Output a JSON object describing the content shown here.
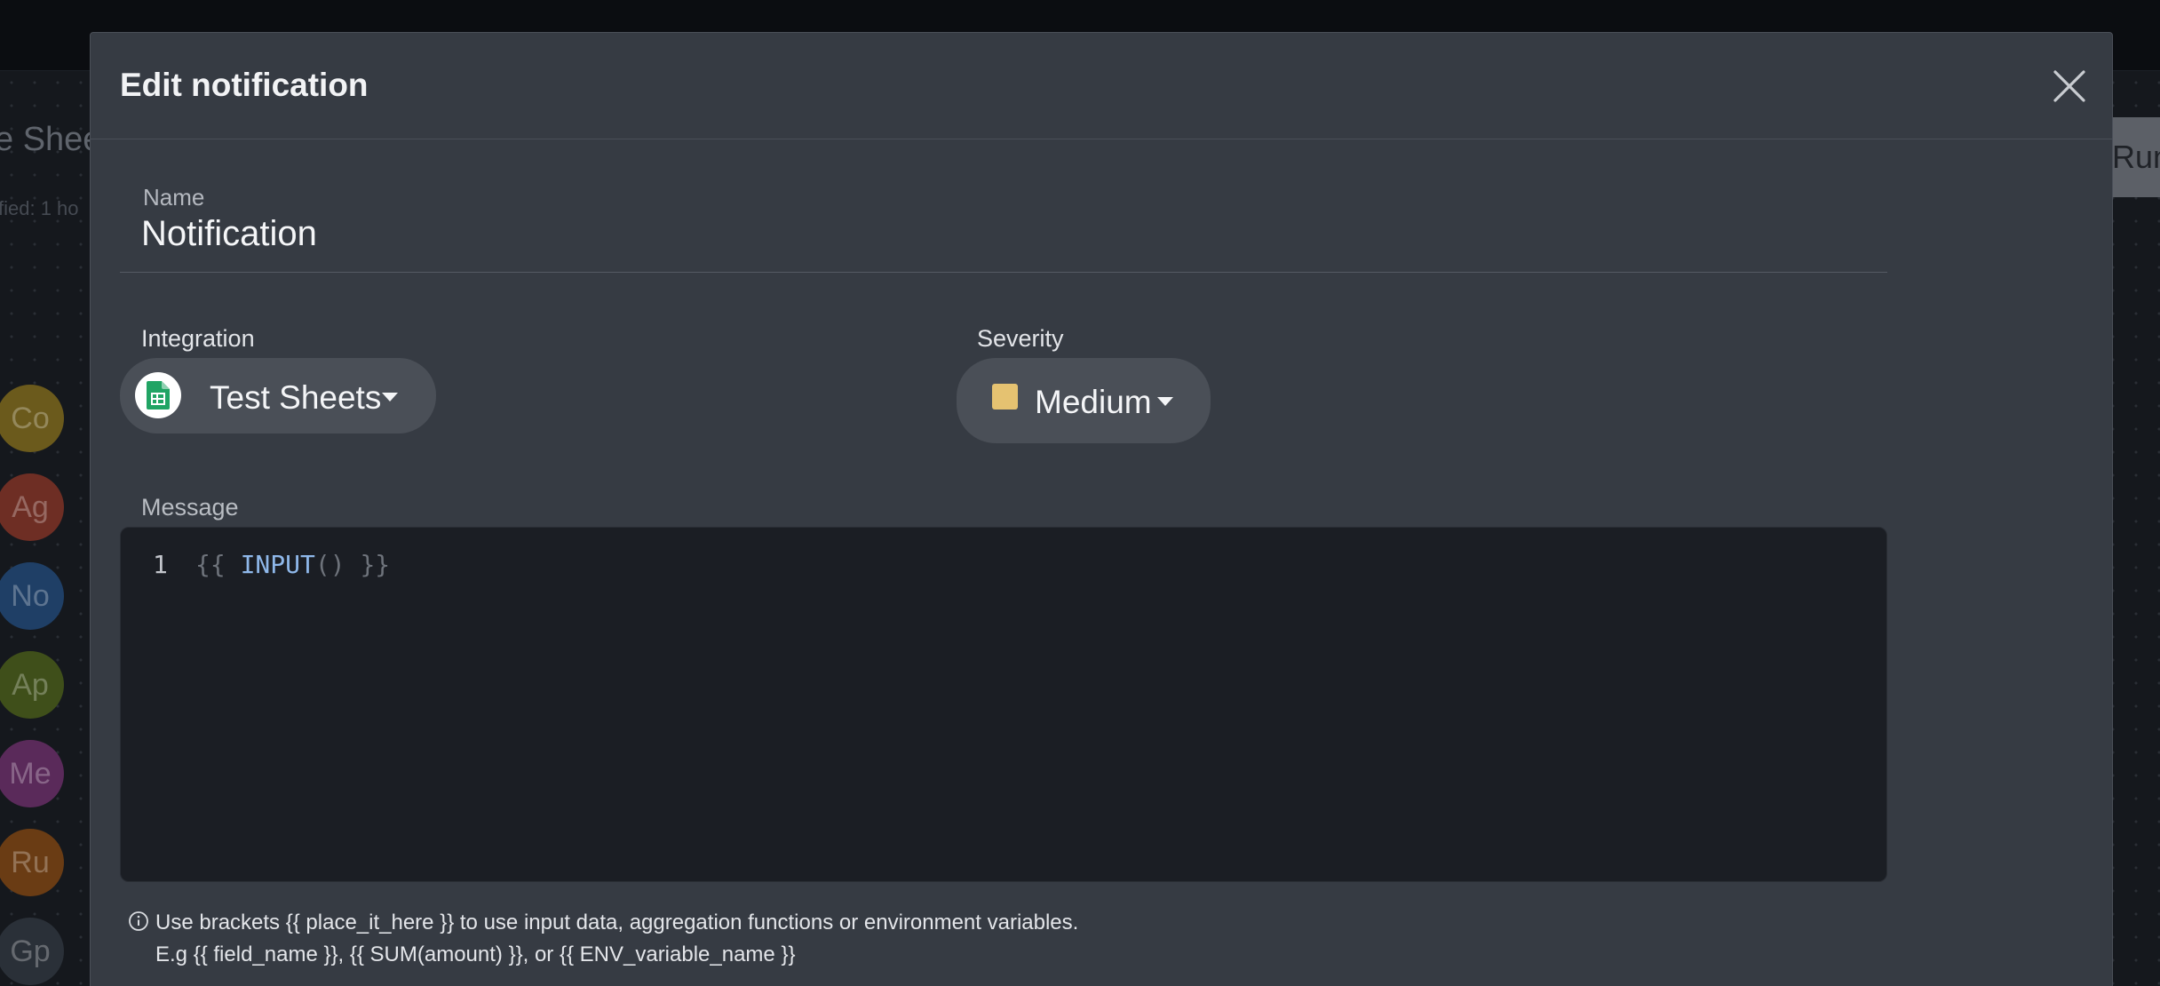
{
  "background": {
    "title_fragment": "e Shee",
    "subtitle_fragment": "fied: 1 ho",
    "run_button_fragment": "Run",
    "nodes": [
      {
        "label": "Co",
        "color": "#6b5a1c"
      },
      {
        "label": "Ag",
        "color": "#6e2e24"
      },
      {
        "label": "No",
        "color": "#1f3f66"
      },
      {
        "label": "Ap",
        "color": "#3f4f1a"
      },
      {
        "label": "Me",
        "color": "#5a2a5a"
      },
      {
        "label": "Ru",
        "color": "#6a3c14"
      },
      {
        "label": "Gp",
        "color": "#2a3038"
      }
    ]
  },
  "modal": {
    "title": "Edit notification",
    "close_icon": "close-icon",
    "name": {
      "label": "Name",
      "value": "Notification"
    },
    "integration": {
      "label": "Integration",
      "value": "Test Sheets",
      "icon": "google-sheets-icon"
    },
    "severity": {
      "label": "Severity",
      "value": "Medium",
      "swatch_color": "#e5c271"
    },
    "message": {
      "label": "Message",
      "line_number": "1",
      "code": {
        "open": "{{ ",
        "fn": "INPUT",
        "parens": "()",
        "close": " }}"
      }
    },
    "hint": {
      "line1": "Use brackets {{ place_it_here }} to use input data, aggregation functions or environment variables.",
      "line2": "E.g {{ field_name }}, {{ SUM(amount) }}, or {{ ENV_variable_name }}"
    }
  }
}
